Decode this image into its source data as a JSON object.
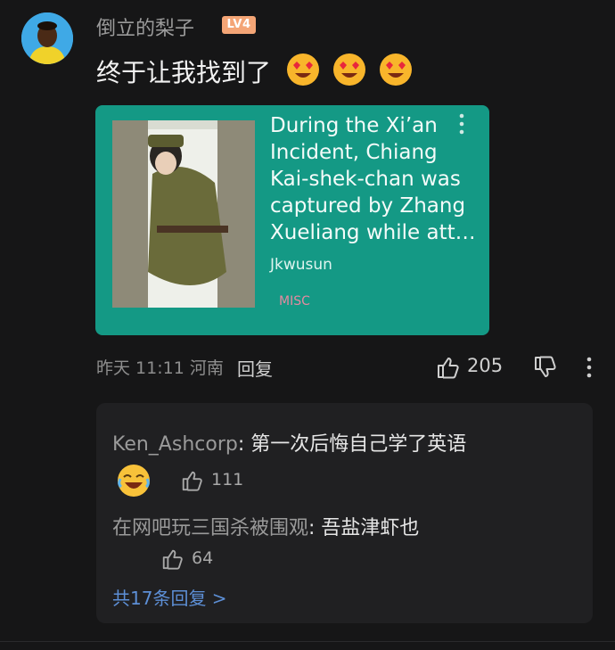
{
  "comment": {
    "username": "倒立的梨子",
    "level": "LV4",
    "text": "终于让我找到了",
    "emojis": [
      "heart-eyes-emoji",
      "heart-eyes-emoji",
      "heart-eyes-emoji"
    ],
    "meta": "昨天 11:11 河南",
    "reply_label": "回复",
    "like_count": "205"
  },
  "card": {
    "title": "During the Xi’an Incident, Chiang Kai-shek-chan was captured by Zhang Xueliang while att…",
    "author": "Jkwusun",
    "tag": "MISC"
  },
  "replies": [
    {
      "name": "Ken_Ashcorp",
      "text": "第一次后悔自己学了英语",
      "like_count": "111"
    },
    {
      "name": "在网吧玩三国杀被围观",
      "text": "吾盐津虾也",
      "like_count": "64"
    }
  ],
  "total_replies": "共17条回复 >",
  "colors": {
    "background": "#161617",
    "card": "#149985",
    "link": "#5d8fd6",
    "level_badge": "#f4a576"
  }
}
